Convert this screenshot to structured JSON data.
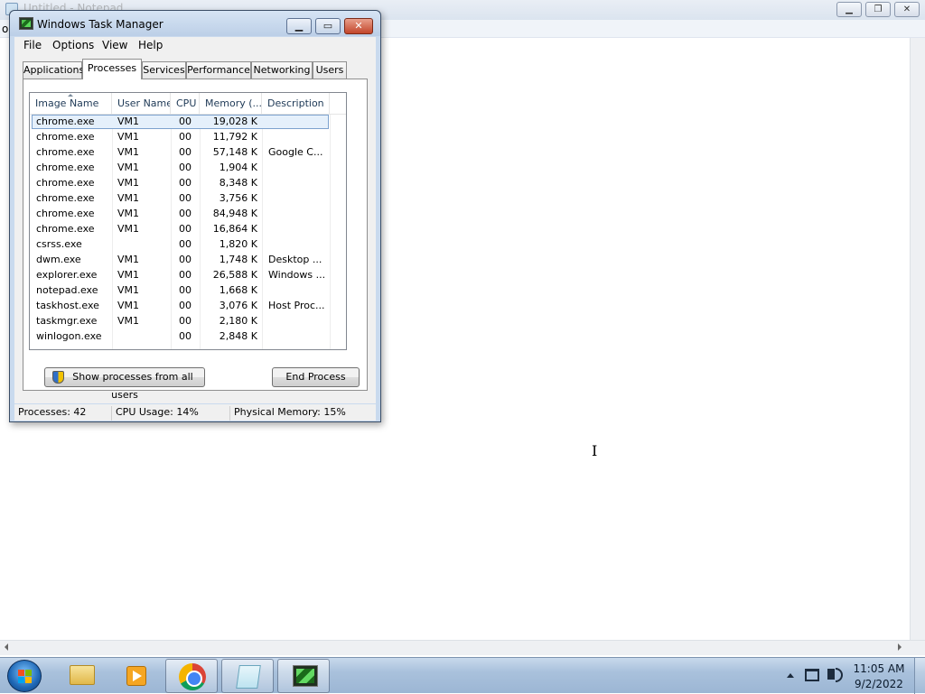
{
  "notepad": {
    "title": "Untitled - Notepad",
    "menu_partial": "o",
    "caption": {
      "minimize": "▁",
      "maximize": "❐",
      "close": "✕"
    }
  },
  "taskmanager": {
    "title": "Windows Task Manager",
    "caption": {
      "minimize": "▁",
      "maximize": "▭",
      "close": "✕"
    },
    "menu": [
      "File",
      "Options",
      "View",
      "Help"
    ],
    "tabs": [
      "Applications",
      "Processes",
      "Services",
      "Performance",
      "Networking",
      "Users"
    ],
    "active_tab": "Processes",
    "columns": [
      "Image Name",
      "User Name",
      "CPU",
      "Memory (...",
      "Description"
    ],
    "processes": [
      {
        "name": "chrome.exe",
        "user": "VM1",
        "cpu": "00",
        "memory": "19,028 K",
        "description": ""
      },
      {
        "name": "chrome.exe",
        "user": "VM1",
        "cpu": "00",
        "memory": "11,792 K",
        "description": ""
      },
      {
        "name": "chrome.exe",
        "user": "VM1",
        "cpu": "00",
        "memory": "57,148 K",
        "description": "Google C..."
      },
      {
        "name": "chrome.exe",
        "user": "VM1",
        "cpu": "00",
        "memory": "1,904 K",
        "description": ""
      },
      {
        "name": "chrome.exe",
        "user": "VM1",
        "cpu": "00",
        "memory": "8,348 K",
        "description": ""
      },
      {
        "name": "chrome.exe",
        "user": "VM1",
        "cpu": "00",
        "memory": "3,756 K",
        "description": ""
      },
      {
        "name": "chrome.exe",
        "user": "VM1",
        "cpu": "00",
        "memory": "84,948 K",
        "description": ""
      },
      {
        "name": "chrome.exe",
        "user": "VM1",
        "cpu": "00",
        "memory": "16,864 K",
        "description": ""
      },
      {
        "name": "csrss.exe",
        "user": "",
        "cpu": "00",
        "memory": "1,820 K",
        "description": ""
      },
      {
        "name": "dwm.exe",
        "user": "VM1",
        "cpu": "00",
        "memory": "1,748 K",
        "description": "Desktop ..."
      },
      {
        "name": "explorer.exe",
        "user": "VM1",
        "cpu": "00",
        "memory": "26,588 K",
        "description": "Windows ..."
      },
      {
        "name": "notepad.exe",
        "user": "VM1",
        "cpu": "00",
        "memory": "1,668 K",
        "description": ""
      },
      {
        "name": "taskhost.exe",
        "user": "VM1",
        "cpu": "00",
        "memory": "3,076 K",
        "description": "Host Proc..."
      },
      {
        "name": "taskmgr.exe",
        "user": "VM1",
        "cpu": "00",
        "memory": "2,180 K",
        "description": ""
      },
      {
        "name": "winlogon.exe",
        "user": "",
        "cpu": "00",
        "memory": "2,848 K",
        "description": ""
      }
    ],
    "selected_row": 0,
    "buttons": {
      "show_all": "Show processes from all users",
      "end_process": "End Process"
    },
    "status": {
      "processes": "Processes: 42",
      "cpu": "CPU Usage: 14%",
      "memory": "Physical Memory: 15%"
    }
  },
  "taskbar": {
    "buttons": [
      "start-orb",
      "windows-explorer",
      "media-player",
      "google-chrome",
      "notepad",
      "task-manager"
    ],
    "clock": {
      "time": "11:05 AM",
      "date": "9/2/2022"
    }
  },
  "colors": {
    "titlebar": "#c9daee",
    "selection": "#e5f0fb",
    "taskbar": "#a9c1dc"
  }
}
